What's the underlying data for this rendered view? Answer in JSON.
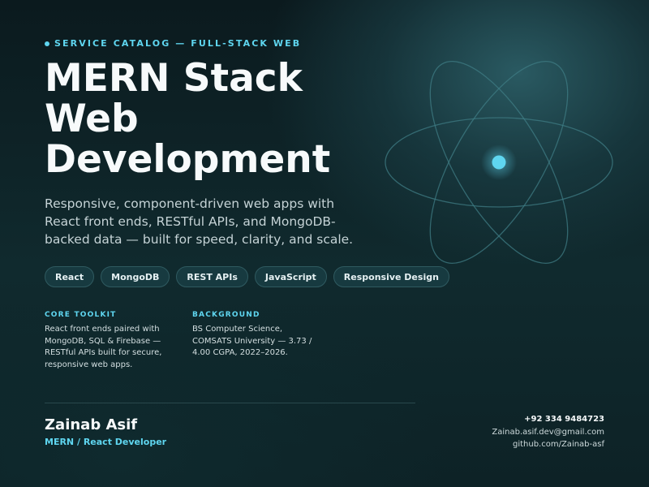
{
  "header": {
    "eyebrow": "SERVICE CATALOG — FULL-STACK WEB",
    "title": "MERN Stack Web Development",
    "subtitle": "Responsive, component-driven web apps with React front ends, RESTful APIs, and MongoDB-backed data — built for speed, clarity, and scale."
  },
  "tags": [
    "React",
    "MongoDB",
    "REST APIs",
    "JavaScript",
    "Responsive Design"
  ],
  "toolkit": {
    "heading": "CORE TOOLKIT",
    "text": "React front ends paired with MongoDB, SQL & Firebase — RESTful APIs built for secure, responsive web apps."
  },
  "background": {
    "heading": "BACKGROUND",
    "text": "BS Computer Science, COMSATS University — 3.73 / 4.00 CGPA, 2022–2026."
  },
  "profile": {
    "name": "Zainab Asif",
    "role": "MERN / React Developer"
  },
  "contact": {
    "phone": "+92 334 9484723",
    "email": "Zainab.asif.dev@gmail.com",
    "github": "github.com/Zainab-asf"
  },
  "colors": {
    "accent": "#5fd6f0",
    "background": "#0d2226",
    "tag_bg": "#173a40"
  },
  "icons": [
    "react-atom-icon"
  ]
}
